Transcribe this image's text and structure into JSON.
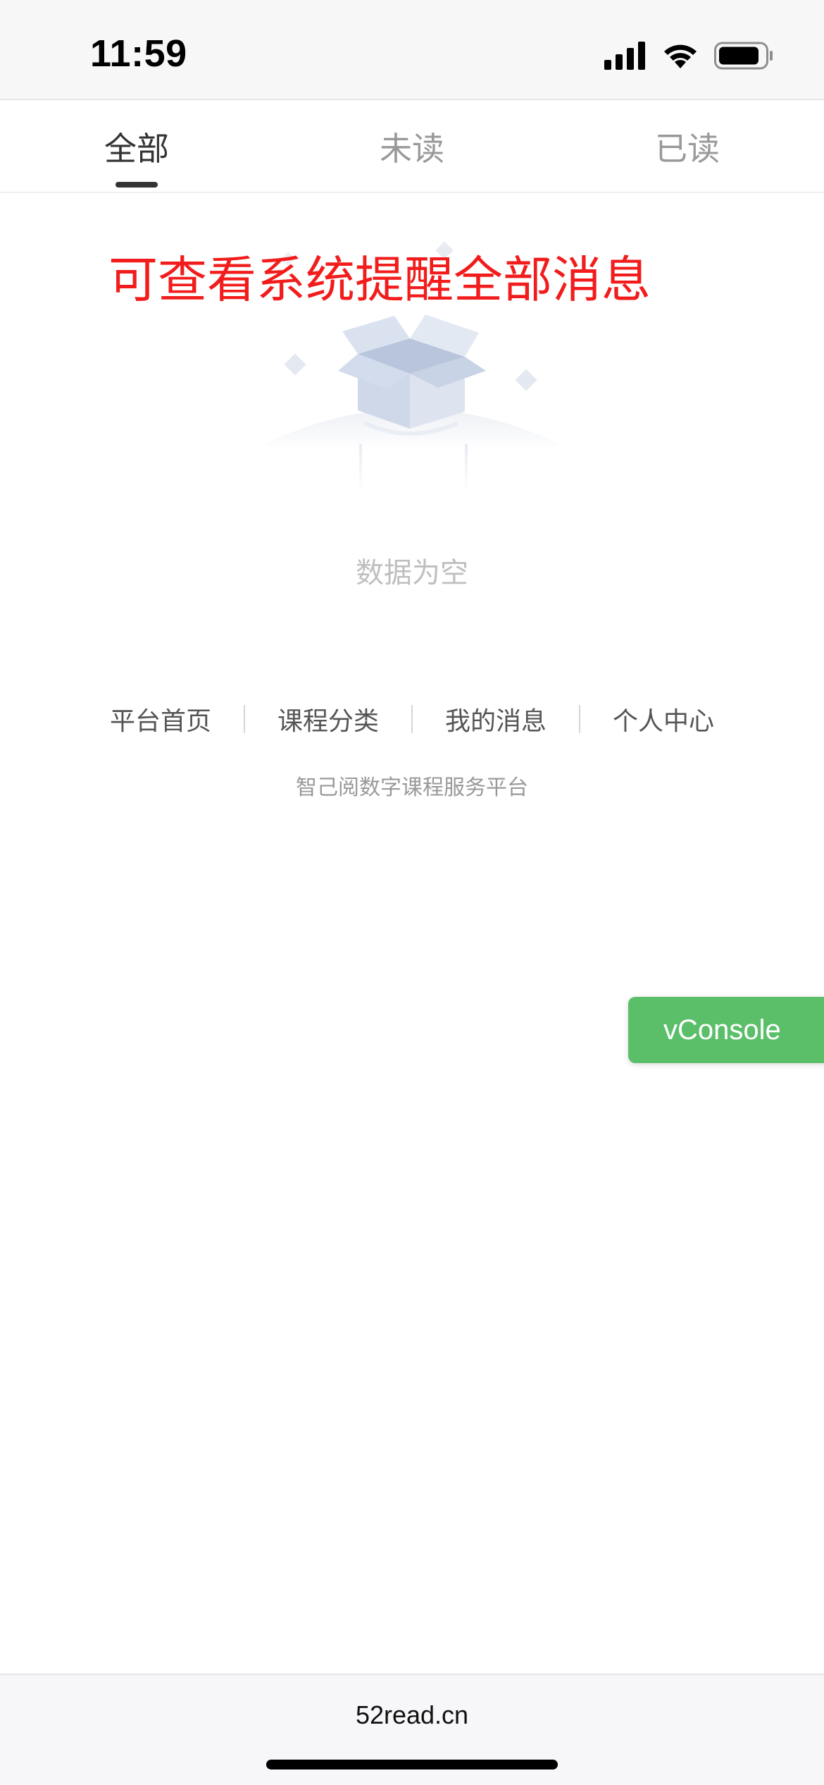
{
  "status_bar": {
    "time": "11:59",
    "icons": [
      "signal-icon",
      "wifi-icon",
      "battery-icon"
    ]
  },
  "tabs": [
    {
      "label": "全部",
      "active": true
    },
    {
      "label": "未读",
      "active": false
    },
    {
      "label": "已读",
      "active": false
    }
  ],
  "annotation": {
    "text": "可查看系统提醒全部消息",
    "color": "#f21c1c"
  },
  "empty_state": {
    "icon": "empty-box-icon",
    "text": "数据为空"
  },
  "footer": {
    "links": [
      "平台首页",
      "课程分类",
      "我的消息",
      "个人中心"
    ],
    "subtitle": "智己阅数字课程服务平台"
  },
  "vconsole": {
    "label": "vConsole",
    "color": "#5bbf6a"
  },
  "browser": {
    "domain": "52read.cn"
  }
}
